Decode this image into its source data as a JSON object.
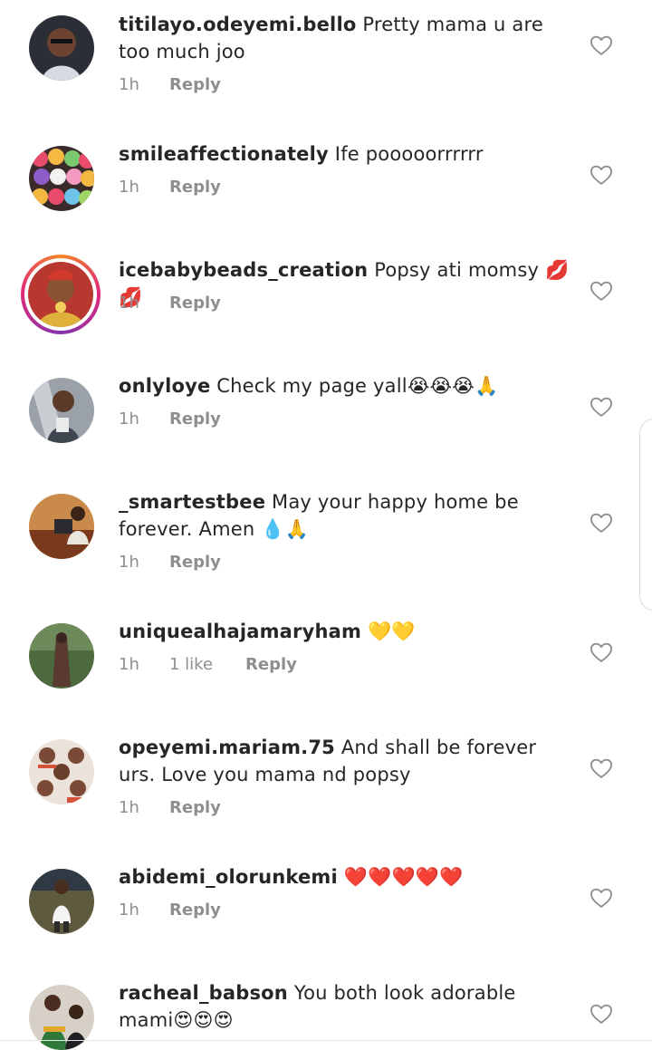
{
  "comments": [
    {
      "username": "titilayo.odeyemi.bello",
      "text": " Pretty mama u are too much joo",
      "time": "1h",
      "reply": "Reply",
      "avatar_color": "#3b3f4a"
    },
    {
      "username": "smileaffectionately",
      "text": " Ife pooooorrrrrr",
      "time": "1h",
      "reply": "Reply",
      "avatar_color": "#d94a6a"
    },
    {
      "username": "icebabybeads_creation",
      "text": " Popsy ati momsy 💋💋",
      "time": "1h",
      "reply": "Reply",
      "avatar_color": "#c9a33c"
    },
    {
      "username": "onlyloye",
      "text": " Check my page yall😭😭😭🙏",
      "time": "1h",
      "reply": "Reply",
      "avatar_color": "#8a8f98"
    },
    {
      "username": "_smartestbee",
      "text": " May your happy home be forever. Amen 💧🙏",
      "time": "1h",
      "reply": "Reply",
      "avatar_color": "#a0552e"
    },
    {
      "username": "uniquealhajamaryham",
      "text": " 💛💛",
      "time": "1h",
      "likes": "1 like",
      "reply": "Reply",
      "avatar_color": "#4a5a3c"
    },
    {
      "username": "opeyemi.mariam.75",
      "text": " And shall be forever urs. Love you mama nd popsy",
      "time": "1h",
      "reply": "Reply",
      "avatar_color": "#d8c7c0"
    },
    {
      "username": "abidemi_olorunkemi",
      "text": " ❤️❤️❤️❤️❤️",
      "time": "1h",
      "reply": "Reply",
      "avatar_color": "#6b6a48"
    },
    {
      "username": "racheal_babson",
      "text": " You both look adorable mami😍😍😍",
      "time": "",
      "reply": "",
      "avatar_color": "#7a3a2c"
    }
  ]
}
